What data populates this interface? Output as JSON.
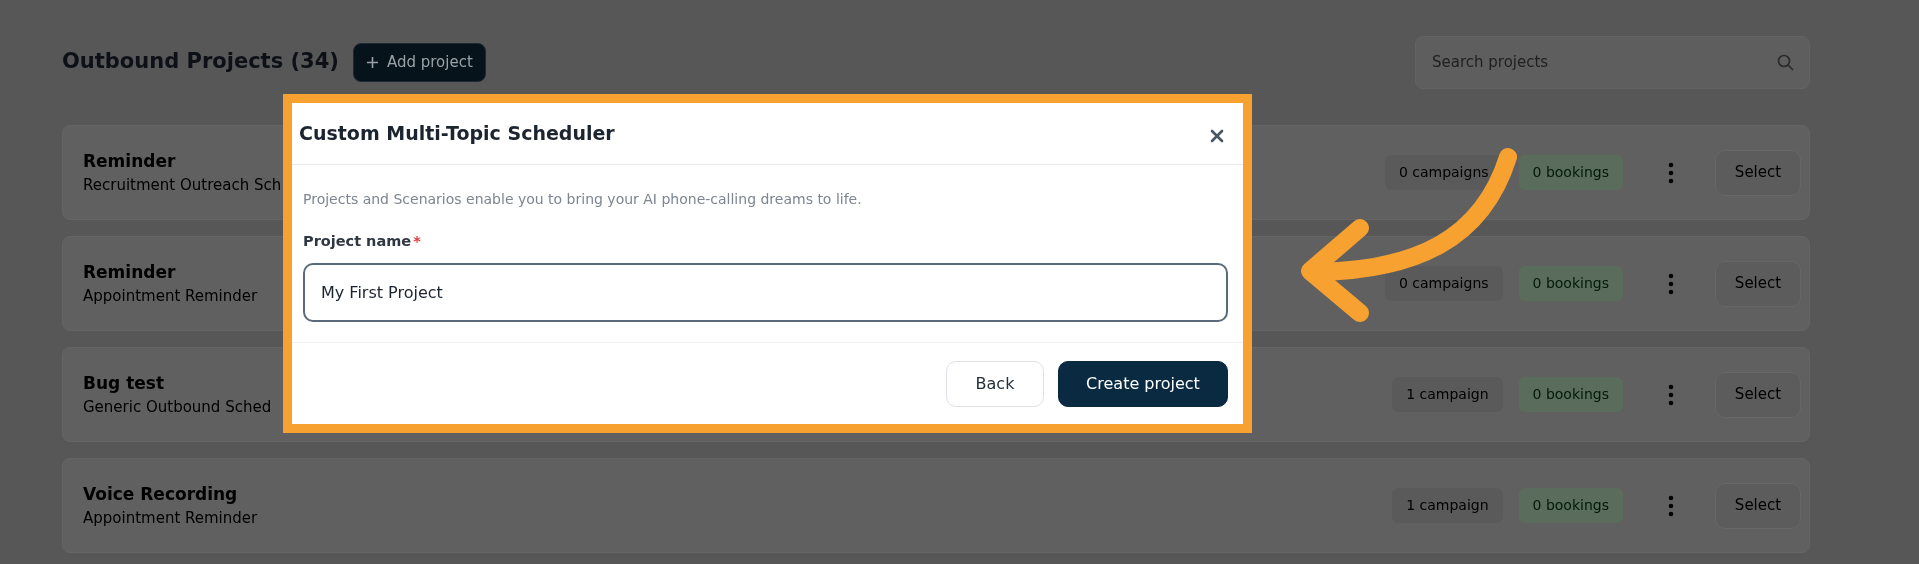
{
  "header": {
    "title": "Outbound Projects (34)",
    "add_button": "Add project"
  },
  "search": {
    "placeholder": "Search projects"
  },
  "projects": [
    {
      "name": "Reminder",
      "template": "Recruitment Outreach Sch",
      "campaigns": "0 campaigns",
      "bookings": "0 bookings",
      "action": "Select"
    },
    {
      "name": "Reminder",
      "template": "Appointment Reminder",
      "campaigns": "0 campaigns",
      "bookings": "0 bookings",
      "action": "Select"
    },
    {
      "name": "Bug test",
      "template": "Generic Outbound Sched",
      "campaigns": "1 campaign",
      "bookings": "0 bookings",
      "action": "Select"
    },
    {
      "name": "Voice Recording",
      "template": "Appointment Reminder",
      "campaigns": "1 campaign",
      "bookings": "0 bookings",
      "action": "Select"
    }
  ],
  "dialog": {
    "title": "Custom Multi-Topic Scheduler",
    "description": "Projects and Scenarios enable you to bring your AI phone-calling dreams to life.",
    "field_label": "Project name",
    "required_mark": "*",
    "value": "My First Project",
    "buttons": [
      {
        "label": "Back",
        "kind": "secondary"
      },
      {
        "label": "Create project",
        "kind": "primary"
      }
    ]
  }
}
